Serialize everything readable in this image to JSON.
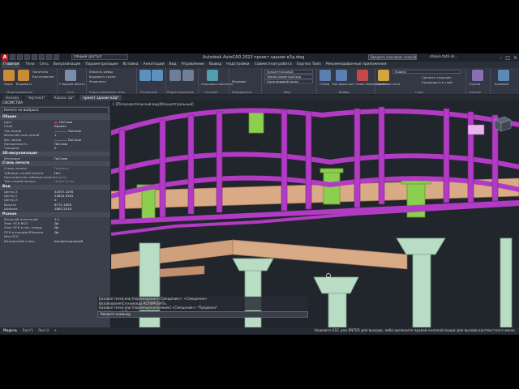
{
  "titlebar": {
    "title": "Autodesk AutoCAD 2022   проект здание в3д.dwg",
    "workspace": "Общий доступ",
    "search": "Введите ключевое слово/фразу",
    "user": "stepin.tatil.sk..."
  },
  "menu": [
    "Главная",
    "Тело",
    "Сеть",
    "Визуализация",
    "Параметризация",
    "Вставка",
    "Аннотации",
    "Вид",
    "Управление",
    "Вывод",
    "Надстройки",
    "Совместная работа",
    "Express Tools",
    "Рекомендованные приложения"
  ],
  "ribbon": {
    "groups": [
      "Моделирование",
      "Сеть",
      "Редактирование тела",
      "Рисование",
      "Редактирование",
      "Сечение",
      "Координаты",
      "Вид",
      "Выбор",
      "Слои",
      "Группы"
    ],
    "big_buttons": [
      "Ящик",
      "Выдавить",
      "Гладкий объект",
      "Секущая плоскость",
      "Отбор",
      "Без фильтра",
      "Гизмо перемещения",
      "Свойства слоя",
      "Группа",
      "Базовый"
    ],
    "small_items": [
      "Политело",
      "Вытягивание",
      "Извлечь ребра",
      "Выдавить грани",
      "Разделить",
      "Мировая",
      "Концептуальный",
      "Неозаглавленный вид",
      "Один видовой экран",
      "Сделать текущим",
      "Копировать в слой"
    ],
    "layer_combo": "Кровля"
  },
  "filetabs": [
    "Начало",
    "Чертеж1*",
    "Каркас 3д*",
    "проект здание в3д*"
  ],
  "properties": {
    "title": "СВОЙСТВА",
    "selection": "Ничего не выбрано",
    "sections": [
      {
        "name": "Общие",
        "rows": [
          {
            "k": "Цвет",
            "v": "ПоСлою",
            "swatch": "#b01e9a"
          },
          {
            "k": "Слой",
            "v": "Кровля"
          },
          {
            "k": "Тип линий",
            "v": "———— ПоСлою"
          },
          {
            "k": "Масштаб типа линий",
            "v": "1"
          },
          {
            "k": "Вес линий",
            "v": "———— ПоСлою"
          },
          {
            "k": "Прозрачность",
            "v": "ПоСлою"
          },
          {
            "k": "Толщина",
            "v": "0"
          }
        ]
      },
      {
        "name": "3D-визуализация",
        "rows": [
          {
            "k": "Материал",
            "v": "ПоСлою"
          }
        ]
      },
      {
        "name": "Стиль печати",
        "rows": [
          {
            "k": "Стиль печати",
            "v": "ПоЦвету",
            "dim": true
          },
          {
            "k": "Таблица стилей печати",
            "v": "Нет"
          },
          {
            "k": "Пространство таблицы печати",
            "v": "Модель",
            "dim": true
          },
          {
            "k": "Тип стилей печати",
            "v": "Недоступно",
            "dim": true
          }
        ]
      },
      {
        "name": "Вид",
        "rows": [
          {
            "k": "Центр X",
            "v": "44557.4295"
          },
          {
            "k": "Центр Y",
            "v": "24810.9561"
          },
          {
            "k": "Центр Z",
            "v": "0"
          },
          {
            "k": "Высота",
            "v": "6774.1800"
          },
          {
            "k": "Ширина",
            "v": "2863.2018"
          }
        ]
      },
      {
        "name": "Разное",
        "rows": [
          {
            "k": "Масштаб аннотаций",
            "v": "1:1"
          },
          {
            "k": "Знак ПСК ВКЛ",
            "v": "Да"
          },
          {
            "k": "Знак ПСК в нач. коорд.",
            "v": "Да"
          },
          {
            "k": "ПСК в каждом ВЭкране",
            "v": "Да"
          },
          {
            "k": "Имя ПСК",
            "v": ""
          },
          {
            "k": "Визуальный стиль",
            "v": "Концептуальный"
          }
        ]
      }
    ]
  },
  "viewport": {
    "label": "[-][Пользовательский вид][Концептуальный]"
  },
  "command": {
    "history": [
      "Базовая точка или [перемещение]<Смещение>: <Смещение>",
      "Возобновляется команда КОПИРОВАТЬ.",
      "Базовая точка или [перемещение/режим] <Смещение>: *Прервано*"
    ],
    "input_placeholder": "Введите команду"
  },
  "layout_tabs": [
    "Модель",
    "Лист1",
    "Лист2",
    "+"
  ],
  "status_message": "Нажмите ESC или ENTER для выхода, либо щелкните правой кнопкой мыши для вызова контекстного меню.",
  "colors": {
    "magenta": "#b13bc2",
    "green": "#8ccf4e",
    "column": "#b9dcc4",
    "timber": "#d9aa86",
    "bg": "#21252c"
  }
}
